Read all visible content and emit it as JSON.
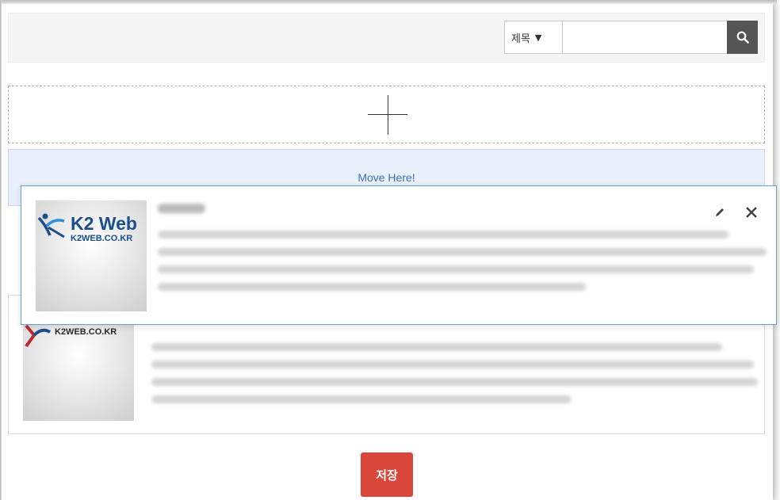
{
  "search": {
    "field_select": "제목",
    "field_select_arrow": "▼",
    "query_value": "",
    "search_icon": "magnifier-icon"
  },
  "add_zone": {
    "icon": "plus-icon"
  },
  "placeholder": {
    "label": "Move Here!"
  },
  "dragging_item": {
    "logo_title": "K2 Web",
    "logo_subtitle": "K2WEB.CO.KR",
    "edit_icon": "pencil-icon",
    "close_icon": "close-icon"
  },
  "list_item": {
    "logo_subtitle": "K2WEB.CO.KR"
  },
  "actions": {
    "save_label": "저장"
  },
  "colors": {
    "placeholder_bg": "#e8f0fb",
    "placeholder_text": "#3d6fb5",
    "drag_border": "#6aa0d6",
    "save_button": "#d9473a",
    "search_button": "#555555",
    "logo_blue": "#1a4f8c"
  }
}
